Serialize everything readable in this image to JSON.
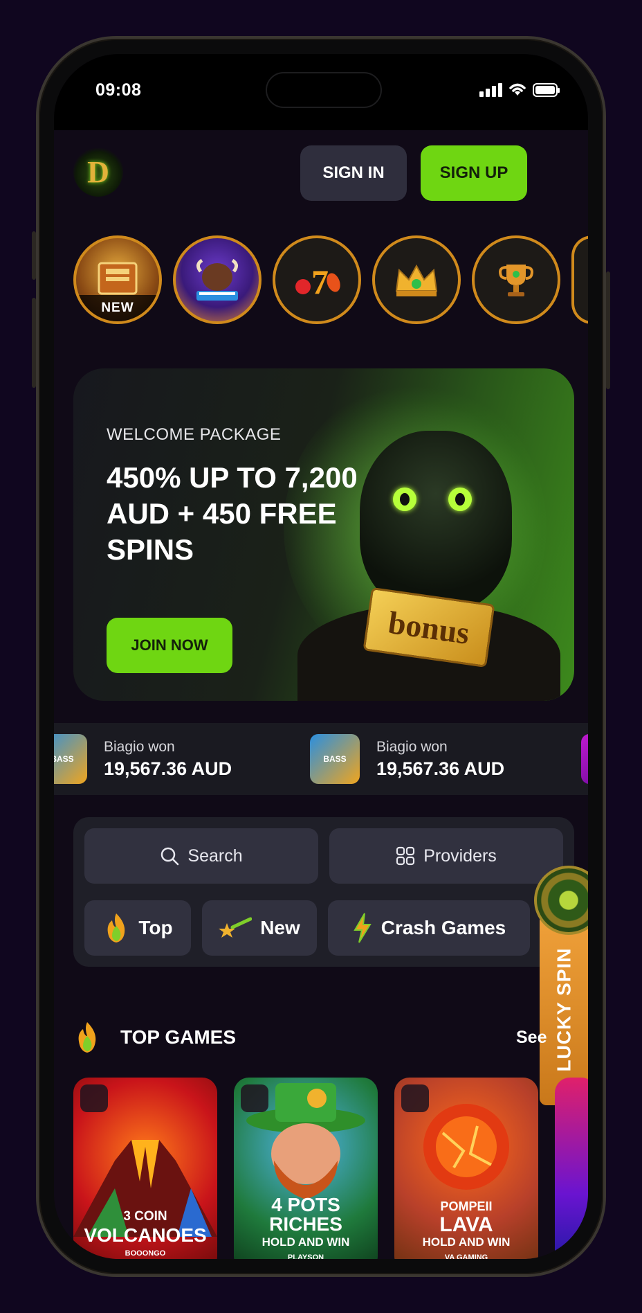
{
  "status_bar": {
    "time": "09:08"
  },
  "header": {
    "logo_letter": "D",
    "signin_label": "SIGN IN",
    "signup_label": "SIGN UP"
  },
  "stories": [
    {
      "name": "book-of-the-dead",
      "tag": "NEW",
      "icon": "book-icon"
    },
    {
      "name": "buffalo-power-megaways",
      "tag": "",
      "icon": "buffalo-icon"
    },
    {
      "name": "slots",
      "tag": "",
      "icon": "seven-cherry-icon"
    },
    {
      "name": "vip",
      "tag": "",
      "icon": "crown-icon"
    },
    {
      "name": "tournaments",
      "tag": "",
      "icon": "trophy-icon"
    }
  ],
  "hero": {
    "subtitle": "WELCOME PACKAGE",
    "title": "450% UP TO 7,200 AUD + 450 FREE SPINS",
    "ticket_text": "bonus",
    "cta_label": "JOIN NOW"
  },
  "winners": [
    {
      "name": "Biagio won",
      "amount": "19,567.36 AUD",
      "game_thumb": "BASS"
    },
    {
      "name": "Biagio won",
      "amount": "19,567.36 AUD",
      "game_thumb": "BASS"
    }
  ],
  "search_panel": {
    "search_label": "Search",
    "providers_label": "Providers",
    "categories": [
      {
        "label": "Top",
        "icon": "fire-icon"
      },
      {
        "label": "New",
        "icon": "shooting-star-icon"
      },
      {
        "label": "Crash Games",
        "icon": "lightning-icon"
      }
    ]
  },
  "lucky_spin": {
    "label": "LUCKY SPIN"
  },
  "top_games": {
    "title": "TOP GAMES",
    "see_all": "See",
    "games": [
      {
        "line1": "3 COIN",
        "line2": "VOLCANOES",
        "provider": "BOOONGO"
      },
      {
        "line1": "4 POTS",
        "line2": "RICHES",
        "line3": "HOLD AND WIN",
        "provider": "PLAYSON"
      },
      {
        "line1": "POMPEII",
        "line2": "LAVA",
        "line3": "HOLD AND WIN",
        "provider": "VA GAMING"
      }
    ]
  },
  "colors": {
    "accent_green": "#6fd612",
    "story_ring": "#d08a1c",
    "background": "#100a17",
    "lucky_orange": "#f0a13a"
  }
}
